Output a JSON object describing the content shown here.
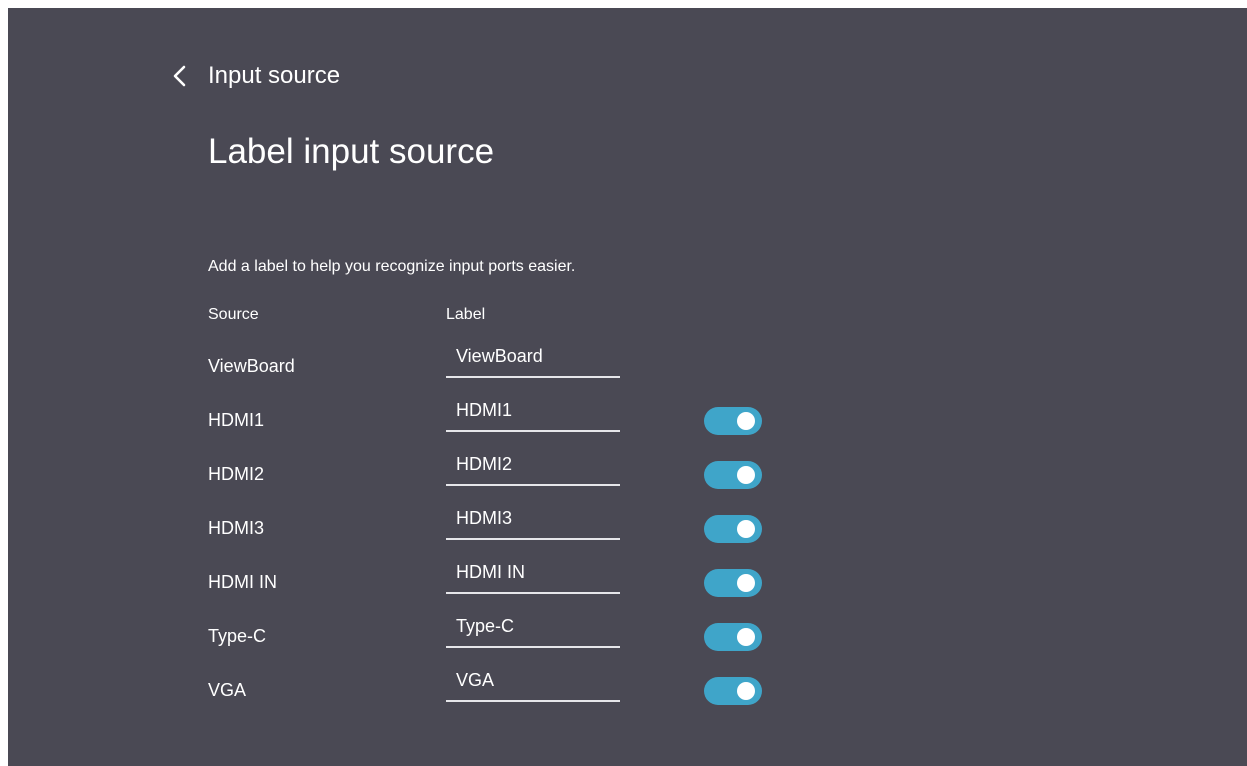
{
  "header": {
    "back_icon": "chevron-left-icon",
    "back_label": "Input source",
    "title": "Label input source"
  },
  "description": "Add a label to help you recognize input ports easier.",
  "columns": {
    "source": "Source",
    "label": "Label"
  },
  "rows": [
    {
      "source": "ViewBoard",
      "label": "ViewBoard",
      "toggle_visible": false,
      "enabled": null
    },
    {
      "source": "HDMI1",
      "label": "HDMI1",
      "toggle_visible": true,
      "enabled": true
    },
    {
      "source": "HDMI2",
      "label": "HDMI2",
      "toggle_visible": true,
      "enabled": true
    },
    {
      "source": "HDMI3",
      "label": "HDMI3",
      "toggle_visible": true,
      "enabled": true
    },
    {
      "source": "HDMI IN",
      "label": "HDMI IN",
      "toggle_visible": true,
      "enabled": true
    },
    {
      "source": "Type-C",
      "label": "Type-C",
      "toggle_visible": true,
      "enabled": true
    },
    {
      "source": "VGA",
      "label": "VGA",
      "toggle_visible": true,
      "enabled": true
    }
  ],
  "colors": {
    "background": "#4a4954",
    "toggle_on": "#3fa5c9",
    "text": "#ffffff",
    "underline": "#e6e6ea"
  }
}
